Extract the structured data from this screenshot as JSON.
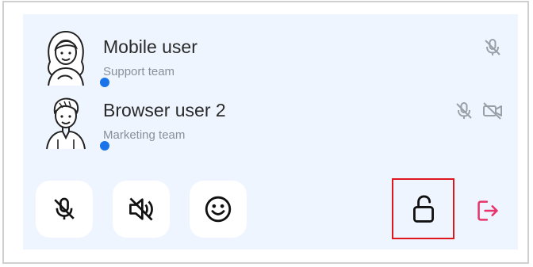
{
  "participants": [
    {
      "name": "Mobile user",
      "team": "Support team",
      "avatar_icon": "female-avatar-icon",
      "status_color": "#1a73e8",
      "indicators": [
        "mic-off-icon"
      ]
    },
    {
      "name": "Browser user 2",
      "team": "Marketing team",
      "avatar_icon": "male-avatar-icon",
      "status_color": "#1a73e8",
      "indicators": [
        "mic-off-icon",
        "video-off-icon"
      ]
    }
  ],
  "controls": {
    "mic_button_icon": "mic-off-icon",
    "speaker_button_icon": "speaker-off-icon",
    "emoji_button_icon": "emoji-icon",
    "lock_button_icon": "unlock-icon",
    "leave_button_icon": "leave-icon"
  },
  "colors": {
    "panel_bg": "#eef5ff",
    "status_online": "#1a73e8",
    "leave_accent": "#e8336b",
    "highlight": "#e0161f",
    "indicator_gray": "#9aa0a6"
  }
}
